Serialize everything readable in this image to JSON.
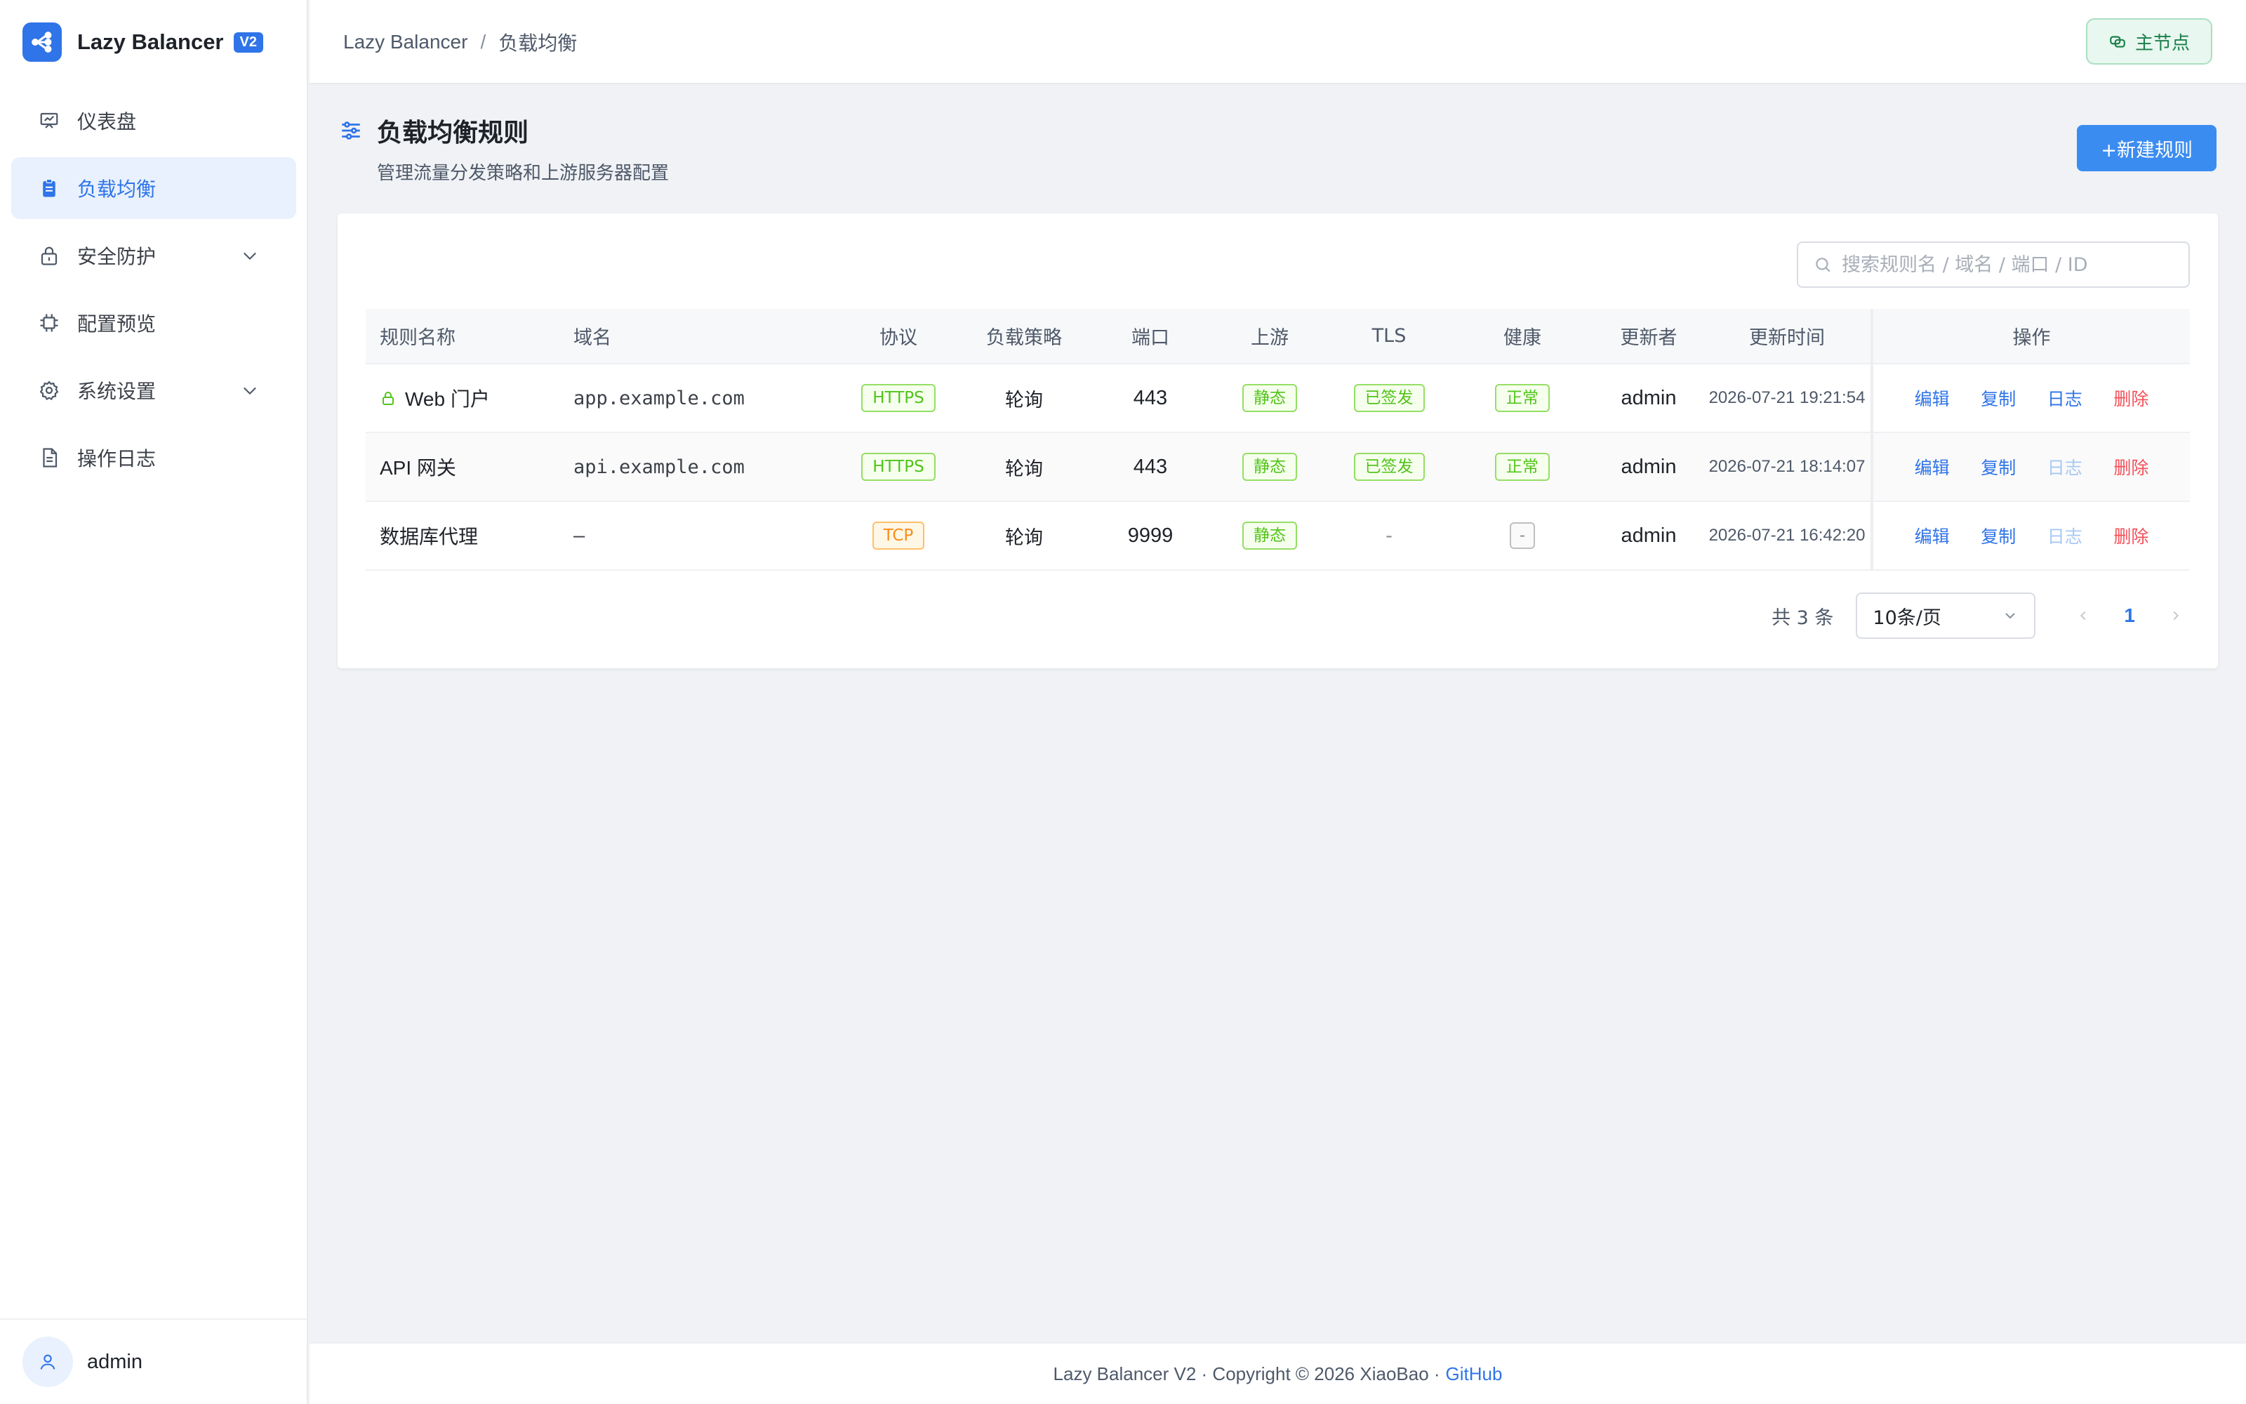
{
  "brand": {
    "name": "Lazy Balancer",
    "badge": "V2"
  },
  "sidebar": {
    "items": [
      {
        "label": "仪表盘",
        "icon": "dashboard-icon"
      },
      {
        "label": "负载均衡",
        "icon": "clipboard-icon",
        "active": true
      },
      {
        "label": "安全防护",
        "icon": "lock-icon",
        "expandable": true
      },
      {
        "label": "配置预览",
        "icon": "chip-icon"
      },
      {
        "label": "系统设置",
        "icon": "gear-icon",
        "expandable": true
      },
      {
        "label": "操作日志",
        "icon": "document-icon"
      }
    ],
    "user": "admin"
  },
  "header": {
    "breadcrumb": [
      "Lazy Balancer",
      "/",
      "负载均衡"
    ],
    "node_button": "主节点"
  },
  "page": {
    "title": "负载均衡规则",
    "subtitle": "管理流量分发策略和上游服务器配置",
    "new_button": "+新建规则"
  },
  "search": {
    "placeholder": "搜索规则名 / 域名 / 端口 / ID"
  },
  "table": {
    "columns": [
      "规则名称",
      "域名",
      "协议",
      "负载策略",
      "端口",
      "上游",
      "TLS",
      "健康",
      "更新者",
      "更新时间",
      "操作"
    ],
    "rows": [
      {
        "name": "Web 门户",
        "locked": true,
        "domain": "app.example.com",
        "protocol": "HTTPS",
        "strategy": "轮询",
        "port": "443",
        "upstream": "静态",
        "tls": "已签发",
        "health": "正常",
        "updater": "admin",
        "updated": "2026-07-21 19:21:54",
        "ops": [
          "编辑",
          "复制",
          "日志",
          "删除"
        ]
      },
      {
        "name": "API 网关",
        "locked": false,
        "domain": "api.example.com",
        "protocol": "HTTPS",
        "strategy": "轮询",
        "port": "443",
        "upstream": "静态",
        "tls": "已签发",
        "health": "正常",
        "updater": "admin",
        "updated": "2026-07-21 18:14:07",
        "ops": [
          "编辑",
          "复制",
          "日志",
          "删除"
        ]
      },
      {
        "name": "数据库代理",
        "locked": false,
        "domain": "–",
        "protocol": "TCP",
        "strategy": "轮询",
        "port": "9999",
        "upstream": "静态",
        "tls": "-",
        "health": "-",
        "updater": "admin",
        "updated": "2026-07-21 16:42:20",
        "ops": [
          "编辑",
          "复制",
          "日志",
          "删除"
        ]
      }
    ]
  },
  "pagination": {
    "total": "共 3 条",
    "page_size": "10条/页",
    "current": "1"
  },
  "footer": {
    "text": "Lazy Balancer V2 · Copyright © 2026 XiaoBao ·",
    "link": "GitHub"
  },
  "colors": {
    "primary": "#2f74e8",
    "success": "#52c41a",
    "warning": "#fa8c16",
    "danger": "#f5505a"
  }
}
